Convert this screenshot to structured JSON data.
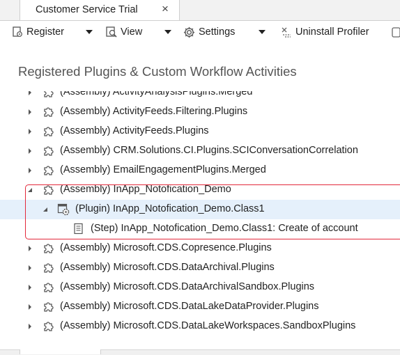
{
  "tab": {
    "title": "Customer Service Trial",
    "close_label": "×"
  },
  "toolbar": {
    "register": {
      "label": "Register",
      "icon": "register-icon"
    },
    "view": {
      "label": "View",
      "icon": "view-icon"
    },
    "settings": {
      "label": "Settings",
      "icon": "gear-icon"
    },
    "uninstall": {
      "label": "Uninstall Profiler",
      "icon": "profiler-icon"
    }
  },
  "heading": "Registered Plugins & Custom Workflow Activities",
  "tree": [
    {
      "type": "assembly",
      "label": "(Assembly) ActivityAnalysisPlugins.Merged",
      "expanded": false
    },
    {
      "type": "assembly",
      "label": "(Assembly) ActivityFeeds.Filtering.Plugins",
      "expanded": false
    },
    {
      "type": "assembly",
      "label": "(Assembly) ActivityFeeds.Plugins",
      "expanded": false
    },
    {
      "type": "assembly",
      "label": "(Assembly) CRM.Solutions.CI.Plugins.SCIConversationCorrelation",
      "expanded": false
    },
    {
      "type": "assembly",
      "label": "(Assembly) EmailEngagementPlugins.Merged",
      "expanded": false
    },
    {
      "type": "assembly",
      "label": "(Assembly) InApp_Notofication_Demo",
      "expanded": true
    },
    {
      "type": "plugin",
      "label": "(Plugin) InApp_Notofication_Demo.Class1",
      "expanded": true,
      "selected": true
    },
    {
      "type": "step",
      "label": "(Step) InApp_Notofication_Demo.Class1: Create of account"
    },
    {
      "type": "assembly",
      "label": "(Assembly) Microsoft.CDS.Copresence.Plugins",
      "expanded": false
    },
    {
      "type": "assembly",
      "label": "(Assembly) Microsoft.CDS.DataArchival.Plugins",
      "expanded": false
    },
    {
      "type": "assembly",
      "label": "(Assembly) Microsoft.CDS.DataArchivalSandbox.Plugins",
      "expanded": false
    },
    {
      "type": "assembly",
      "label": "(Assembly) Microsoft.CDS.DataLakeDataProvider.Plugins",
      "expanded": false
    },
    {
      "type": "assembly",
      "label": "(Assembly) Microsoft.CDS.DataLakeWorkspaces.SandboxPlugins",
      "expanded": false
    }
  ],
  "colors": {
    "highlight": "#e3283a",
    "selected_row": "#e5f0fb",
    "heading": "#555555"
  }
}
